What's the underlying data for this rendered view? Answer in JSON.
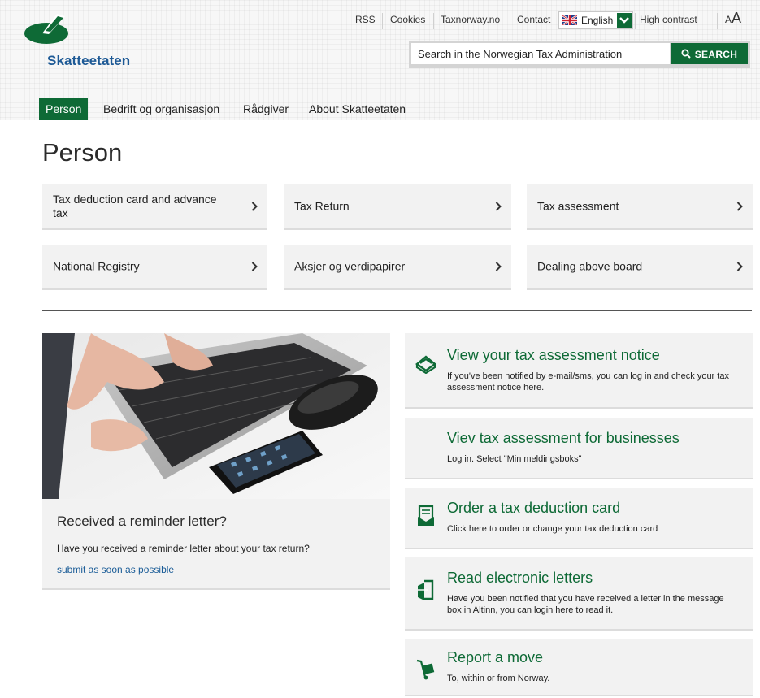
{
  "brand": {
    "name": "Skatteetaten",
    "green": "#0e6a36",
    "blue": "#1e5a96"
  },
  "utility_links": {
    "rss": "RSS",
    "cookies": "Cookies",
    "taxnorway": "Taxnorway.no",
    "contact": "Contact",
    "language": "English",
    "high_contrast": "High contrast",
    "text_size_small": "A",
    "text_size_large": "A"
  },
  "search": {
    "value": "Search in the Norwegian Tax Administration",
    "button_label": "SEARCH"
  },
  "main_nav": [
    {
      "label": "Person",
      "active": true
    },
    {
      "label": "Bedrift og organisasjon",
      "active": false
    },
    {
      "label": "Rådgiver",
      "active": false
    },
    {
      "label": "About Skatteetaten",
      "active": false
    }
  ],
  "page_title": "Person",
  "tiles": [
    {
      "label": "Tax deduction card and advance tax"
    },
    {
      "label": "Tax Return"
    },
    {
      "label": "Tax assessment"
    },
    {
      "label": "National Registry"
    },
    {
      "label": "Aksjer og verdipapirer"
    },
    {
      "label": "Dealing above board"
    }
  ],
  "promo": {
    "title": "Received a reminder letter?",
    "text": "Have you received a reminder letter about your tax return?",
    "link": "submit as soon as possible"
  },
  "cards": [
    {
      "icon": "tax-notice-icon",
      "title": "View your tax assessment notice",
      "desc": "If you've been notified by e-mail/sms, you can log in and check your tax assessment notice here."
    },
    {
      "icon": "",
      "title": "Viev tax assessment for businesses",
      "desc": "Log in. Select \"Min meldingsboks\""
    },
    {
      "icon": "tax-card-icon",
      "title": "Order a tax deduction card",
      "desc": "Click here to order or change your tax deduction card"
    },
    {
      "icon": "door-login-icon",
      "title": "Read electronic letters",
      "desc": "Have you been notified that you have received a letter in the message box in Altinn, you can login here to read it."
    },
    {
      "icon": "hand-truck-icon",
      "title": "Report a move",
      "desc": "To, within or from Norway."
    }
  ]
}
